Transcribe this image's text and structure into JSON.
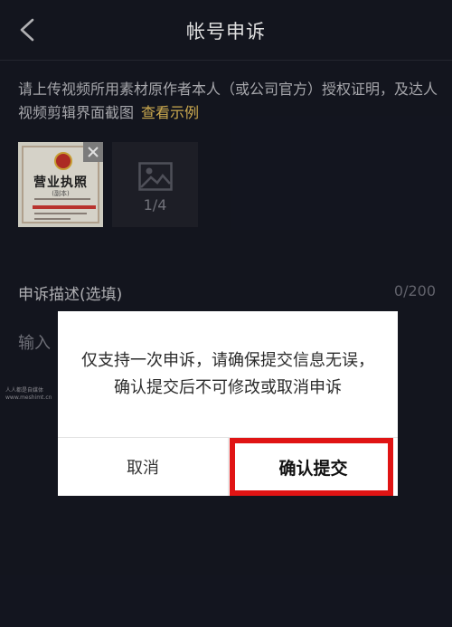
{
  "header": {
    "title": "帐号申诉",
    "back_icon": "chevron-left-icon"
  },
  "instruction": {
    "text": "请上传视频所用素材原作者本人（或公司官方）授权证明，及达人视频剪辑界面截图",
    "example_link": "查看示例"
  },
  "uploads": {
    "license_thumbnail": {
      "title": "营业执照",
      "subtitle": "(副本)"
    },
    "remove_icon": "close-icon",
    "add_slot": {
      "icon": "image-icon",
      "count": "1/4"
    }
  },
  "description": {
    "label": "申诉描述(选填)",
    "counter": "0/200",
    "placeholder": "输入"
  },
  "watermark": {
    "line1": "人人都是自媒体",
    "line2": "www.meshimt.cn"
  },
  "dialog": {
    "message": "仅支持一次申诉，请确保提交信息无误，确认提交后不可修改或取消申诉",
    "cancel_label": "取消",
    "confirm_label": "确认提交"
  },
  "colors": {
    "background": "#161823",
    "link": "#e8c15a",
    "highlight": "#e01414",
    "dialog_bg": "#ffffff"
  }
}
